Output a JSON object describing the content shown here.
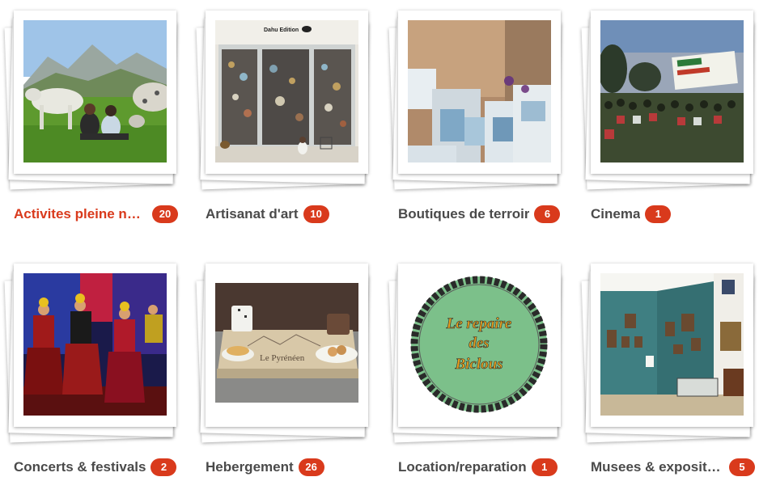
{
  "colors": {
    "accent": "#d93a1c",
    "label_text": "#4a4a4a",
    "badge_text": "#ffffff"
  },
  "categories": [
    {
      "label": "Activites pleine nature",
      "count": "20",
      "active": true,
      "photo": "horses-meadow"
    },
    {
      "label": "Artisanat d'art",
      "count": "10",
      "active": false,
      "photo": "shop-front",
      "photo_text": "Dahu Edition"
    },
    {
      "label": "Boutiques de terroir",
      "count": "6",
      "active": false,
      "photo": "boutique-shelves"
    },
    {
      "label": "Cinema",
      "count": "1",
      "active": false,
      "photo": "outdoor-cinema"
    },
    {
      "label": "Concerts & festivals",
      "count": "2",
      "active": false,
      "photo": "dancers-stage"
    },
    {
      "label": "Hebergement",
      "count": "26",
      "active": false,
      "photo": "breakfast-tray",
      "photo_text": "Le Pyrénéen"
    },
    {
      "label": "Location/reparation",
      "count": "1",
      "active": false,
      "photo": "bike-logo",
      "photo_text": [
        "Le repaire",
        "des",
        "Biclous"
      ]
    },
    {
      "label": "Musees & expositions",
      "count": "5",
      "active": false,
      "photo": "museum-room"
    }
  ]
}
